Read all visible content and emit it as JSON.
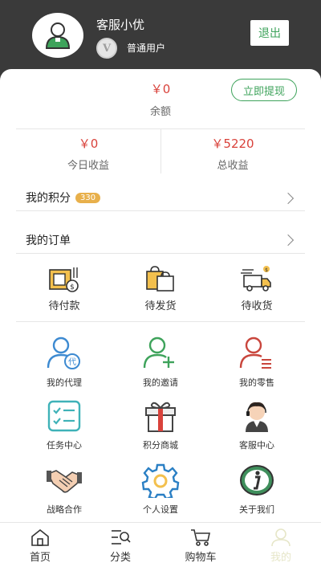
{
  "header": {
    "username": "客服小优",
    "level_badge": "V",
    "level_text": "普通用户",
    "logout_label": "退出"
  },
  "balance": {
    "value": "￥0",
    "label": "余额",
    "withdraw_label": "立即提现"
  },
  "earnings": {
    "today_value": "￥0",
    "today_label": "今日收益",
    "total_value": "￥5220",
    "total_label": "总收益"
  },
  "points": {
    "label": "我的积分",
    "count": "330"
  },
  "orders": {
    "label": "我的订单",
    "items": [
      {
        "label": "待付款",
        "icon": "wallet-icon"
      },
      {
        "label": "待发货",
        "icon": "shopping-bags-icon"
      },
      {
        "label": "待收货",
        "icon": "delivery-truck-icon"
      }
    ]
  },
  "grid": [
    {
      "label": "我的代理",
      "icon": "agent-icon"
    },
    {
      "label": "我的邀请",
      "icon": "add-user-icon"
    },
    {
      "label": "我的零售",
      "icon": "retail-user-icon"
    },
    {
      "label": "任务中心",
      "icon": "task-list-icon"
    },
    {
      "label": "积分商城",
      "icon": "gift-icon"
    },
    {
      "label": "客服中心",
      "icon": "customer-service-icon"
    },
    {
      "label": "战略合作",
      "icon": "handshake-icon"
    },
    {
      "label": "个人设置",
      "icon": "settings-gear-icon"
    },
    {
      "label": "关于我们",
      "icon": "info-icon"
    }
  ],
  "nav": [
    {
      "label": "首页",
      "icon": "home-icon"
    },
    {
      "label": "分类",
      "icon": "category-icon"
    },
    {
      "label": "购物车",
      "icon": "cart-icon"
    },
    {
      "label": "我的",
      "icon": "profile-icon",
      "active": true
    }
  ],
  "colors": {
    "header_bg": "#3a3a3a",
    "accent_green": "#3ea35b",
    "price_red": "#d9423b",
    "points_badge": "#e8b04b"
  }
}
